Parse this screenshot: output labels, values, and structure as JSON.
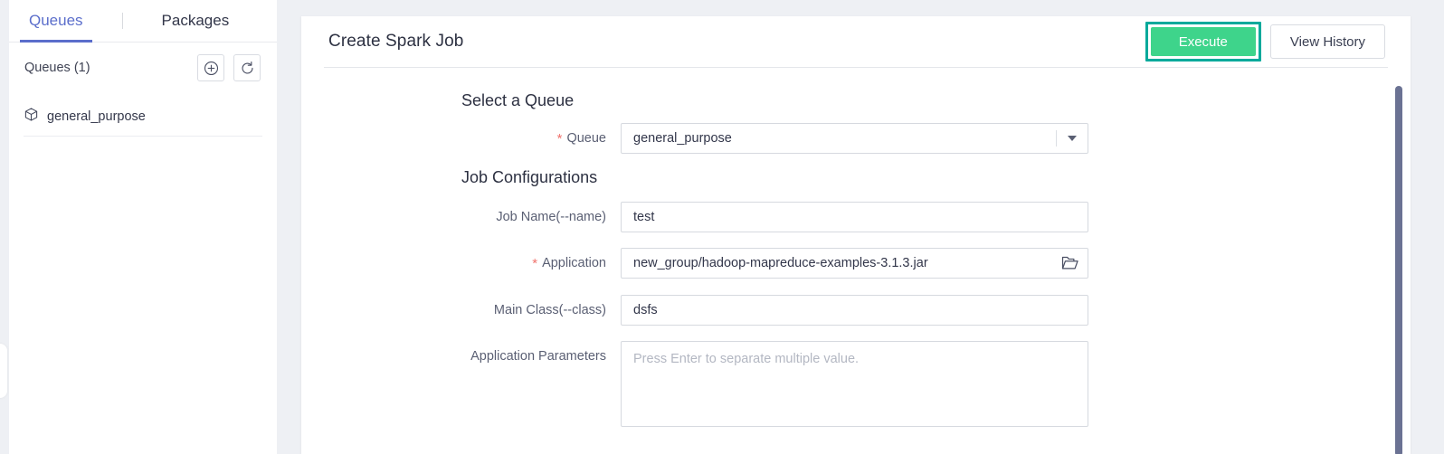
{
  "sidebar": {
    "tabs": [
      {
        "label": "Queues",
        "active": true
      },
      {
        "label": "Packages",
        "active": false
      }
    ],
    "queues_header": "Queues (1)",
    "add_icon": "plus-circle-icon",
    "refresh_icon": "refresh-icon",
    "items": [
      {
        "label": "general_purpose",
        "icon": "cube-icon"
      }
    ]
  },
  "main": {
    "title": "Create Spark Job",
    "execute_label": "Execute",
    "view_history_label": "View History",
    "sections": {
      "queue_title": "Select a Queue",
      "job_config_title": "Job Configurations"
    },
    "fields": {
      "queue": {
        "label": "Queue",
        "required": true,
        "value": "general_purpose",
        "control": "select",
        "caret_icon": "chevron-down-icon"
      },
      "job_name": {
        "label": "Job Name(--name)",
        "required": false,
        "value": "test",
        "control": "text"
      },
      "application": {
        "label": "Application",
        "required": true,
        "value": "new_group/hadoop-mapreduce-examples-3.1.3.jar",
        "control": "text",
        "trailing_icon": "folder-open-icon"
      },
      "main_class": {
        "label": "Main Class(--class)",
        "required": false,
        "value": "dsfs",
        "control": "text"
      },
      "application_parameters": {
        "label": "Application Parameters",
        "required": false,
        "value": "",
        "placeholder": "Press Enter to separate multiple value.",
        "control": "textarea"
      }
    }
  },
  "colors": {
    "accent_blue": "#5b6ecb",
    "execute_green": "#3ed48b",
    "execute_highlight": "#00a99b",
    "required_star": "#f0736d",
    "scrollbar": "#6b7293",
    "page_bg": "#eef0f4"
  }
}
